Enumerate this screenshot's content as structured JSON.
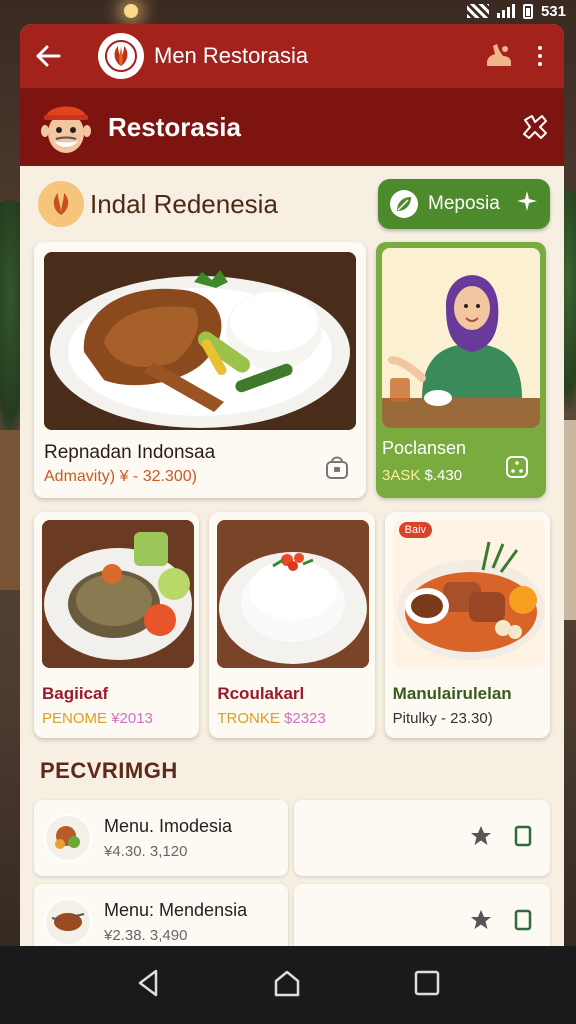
{
  "status": {
    "time": "531"
  },
  "appbar": {
    "title": "Men Restorasia"
  },
  "subbar": {
    "title": "Restorasia"
  },
  "section": {
    "title": "Indal Redenesia",
    "button_label": "Meposia"
  },
  "featured": {
    "name": "Repnadan Indonsaa",
    "price": "Admavity) ¥ - 32.300)"
  },
  "promo": {
    "name": "Poclansen",
    "price_a": "3ASK",
    "price_b": "$.430"
  },
  "dishes": [
    {
      "name": "Bagiicaf",
      "code": "PENOME",
      "price": "¥2013"
    },
    {
      "name": "Rcoulakarl",
      "code": "TRONKE",
      "price": "$2323"
    },
    {
      "name": "Manulairulelan",
      "badge": "Baiv",
      "price": "Pitulky - 23.30)"
    }
  ],
  "list": {
    "header": "PECVRIMGH",
    "items": [
      {
        "name": "Menu. Imodesia",
        "price": "¥4.30. 3,120"
      },
      {
        "name": "Menu: Mendensia",
        "price": "¥2.38. 3,490"
      }
    ]
  },
  "colors": {
    "primary": "#a3221c",
    "secondary": "#7d1410",
    "accent_green": "#4d8a2c",
    "background": "#f6efe2"
  },
  "icons": [
    "back-arrow-icon",
    "leaf-logo-icon",
    "mascot-icon",
    "close-icon",
    "star-icon",
    "square-icon",
    "home-icon",
    "recents-icon",
    "nav-back-icon"
  ]
}
